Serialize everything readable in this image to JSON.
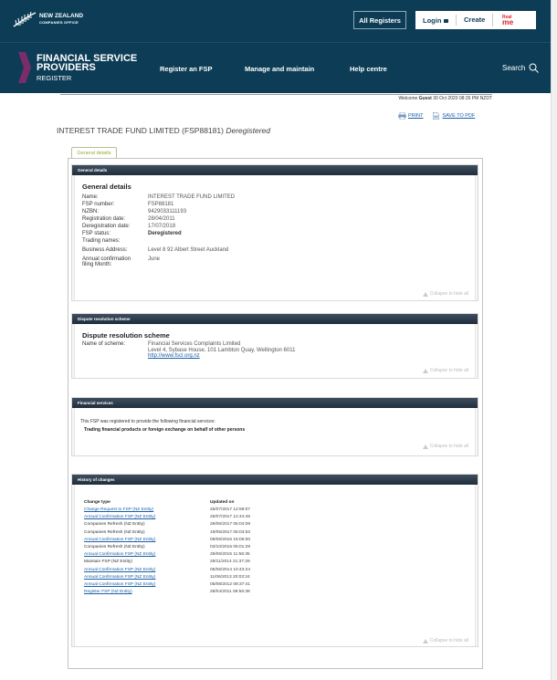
{
  "top": {
    "org_line1": "NEW ZEALAND",
    "org_line2": "COMPANIES OFFICE",
    "all_registers": "All Registers",
    "login": "Login",
    "create": "Create",
    "realme_line1": "Real",
    "realme_line2": "me"
  },
  "nav": {
    "brand_line1": "FINANCIAL SERVICE",
    "brand_line2": "PROVIDERS",
    "brand_line3": "REGISTER",
    "items": [
      "Register an FSP",
      "Manage and maintain",
      "Help centre"
    ],
    "search": "Search"
  },
  "welcome": {
    "prefix": "Welcome",
    "user": "Guest",
    "datetime": "30 Oct 2020 08:26 PM NZDT"
  },
  "actions": {
    "print": "PRINT",
    "save_pdf": "SAVE TO PDF"
  },
  "firm": {
    "name": "INTEREST TRADE FUND LIMITED (FSP88181)",
    "status": "Deregistered"
  },
  "tab_label": "General details",
  "collapse_label": "Collapse to hide all",
  "general": {
    "header": "General details",
    "title": "General details",
    "fields": [
      {
        "k": "Name:",
        "v": "INTEREST TRADE FUND LIMITED"
      },
      {
        "k": "FSP number:",
        "v": "FSP88181"
      },
      {
        "k": "NZBN:",
        "v": "9429033111193"
      },
      {
        "k": "Registration date:",
        "v": "28/04/2011"
      },
      {
        "k": "Deregistration date:",
        "v": "17/07/2018"
      },
      {
        "k": "FSP status:",
        "v": "Deregistered"
      },
      {
        "k": "Trading names:",
        "v": ""
      },
      {
        "k": "Business Address:",
        "v": "Level 8 92 Albert Street Auckland"
      }
    ],
    "annual_k1": "Annual confirmation",
    "annual_k2": "filing Month:",
    "annual_v": "June"
  },
  "dispute": {
    "header": "Dispute resolution scheme",
    "title": "Dispute resolution scheme",
    "label": "Name of scheme:",
    "line1": "Financial Services Complaints Limited",
    "line2": "Level 4, Sybase House, 101 Lambton Quay, Wellington 6011",
    "url": "http://www.fscl.org.nz"
  },
  "services": {
    "header": "Financial services",
    "intro": "This FSP was registered to provide the following financial services:",
    "item": "Trading financial products or foreign exchange on behalf of other persons"
  },
  "history": {
    "header": "History of changes",
    "col1": "Change type",
    "col2": "Updated on",
    "rows": [
      {
        "type": "Change Request to FSP (NZ Entity)",
        "date": "25/07/2017 12:59:07",
        "link": true
      },
      {
        "type": "Annual Confirmation FSP (NZ Entity)",
        "date": "25/07/2017 12:44:45",
        "link": true
      },
      {
        "type": "Companies Refresh (NZ Entity)",
        "date": "29/06/2017 05:04:08",
        "link": false
      },
      {
        "type": "Companies Refresh (NZ Entity)",
        "date": "19/05/2017 05:03:52",
        "link": false
      },
      {
        "type": "Annual Confirmation FSP (NZ Entity)",
        "date": "09/06/2016 15:06:00",
        "link": true
      },
      {
        "type": "Companies Refresh (NZ Entity)",
        "date": "03/10/2015 05:01:29",
        "link": false
      },
      {
        "type": "Annual Confirmation FSP (NZ Entity)",
        "date": "29/06/2015 11:56:35",
        "link": true
      },
      {
        "type": "Maintain FSP (NZ Entity)",
        "date": "29/11/2014 21:37:29",
        "link": false
      },
      {
        "type": "Annual Confirmation FSP (NZ Entity)",
        "date": "05/06/2014 10:43:24",
        "link": true
      },
      {
        "type": "Annual Confirmation FSP (NZ Entity)",
        "date": "11/06/2013 20:03:24",
        "link": true
      },
      {
        "type": "Annual Confirmation FSP (NZ Entity)",
        "date": "05/08/2012 09:37:41",
        "link": true
      },
      {
        "type": "Register FSP (NZ Entity)",
        "date": "28/04/2011 08:56:38",
        "link": true
      }
    ]
  }
}
